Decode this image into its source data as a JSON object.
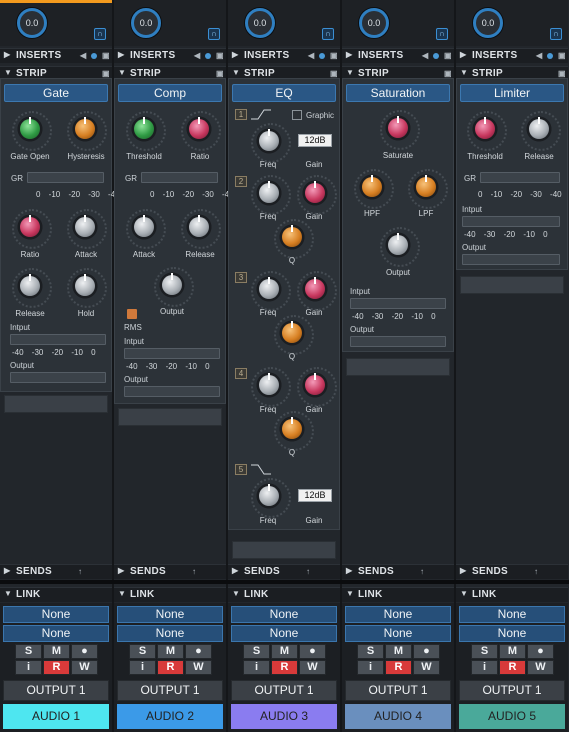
{
  "channels": [
    {
      "volume": "0.0",
      "inserts": "INSERTS",
      "strip": "STRIP",
      "plugin": "Gate",
      "sends": "SENDS",
      "link": "LINK",
      "link_a": "None",
      "link_b": "None",
      "output": "OUTPUT 1",
      "track": "AUDIO 1",
      "track_color": "#4ee6f0",
      "knobs": {
        "k1": "Gate Open",
        "k2": "Hysteresis",
        "k3": "Ratio",
        "k4": "Attack",
        "k5": "Release",
        "k6": "Hold"
      }
    },
    {
      "volume": "0.0",
      "inserts": "INSERTS",
      "strip": "STRIP",
      "plugin": "Comp",
      "sends": "SENDS",
      "link": "LINK",
      "link_a": "None",
      "link_b": "None",
      "output": "OUTPUT 1",
      "track": "AUDIO 2",
      "track_color": "#3b9ae8",
      "knobs": {
        "k1": "Threshold",
        "k2": "Ratio",
        "k3": "Attack",
        "k4": "Release",
        "k5": "Output"
      },
      "rms": "RMS"
    },
    {
      "volume": "0.0",
      "inserts": "INSERTS",
      "strip": "STRIP",
      "plugin": "EQ",
      "sends": "SENDS",
      "link": "LINK",
      "link_a": "None",
      "link_b": "None",
      "output": "OUTPUT 1",
      "track": "AUDIO 3",
      "track_color": "#8a7cf0",
      "graphic": "Graphic",
      "gain1": "12dB",
      "gain5": "12dB",
      "freq": "Freq",
      "gain": "Gain",
      "q": "Q",
      "bands": [
        "1",
        "2",
        "3",
        "4",
        "5"
      ]
    },
    {
      "volume": "0.0",
      "inserts": "INSERTS",
      "strip": "STRIP",
      "plugin": "Saturation",
      "sends": "SENDS",
      "link": "LINK",
      "link_a": "None",
      "link_b": "None",
      "output": "OUTPUT 1",
      "track": "AUDIO 4",
      "track_color": "#6a8fbe",
      "knobs": {
        "k1": "Saturate",
        "k2": "HPF",
        "k3": "LPF",
        "k4": "Output"
      }
    },
    {
      "volume": "0.0",
      "inserts": "INSERTS",
      "strip": "STRIP",
      "plugin": "Limiter",
      "sends": "SENDS",
      "link": "LINK",
      "link_a": "None",
      "link_b": "None",
      "output": "OUTPUT 1",
      "track": "AUDIO 5",
      "track_color": "#4aa99a",
      "knobs": {
        "k1": "Threshold",
        "k2": "Release"
      }
    }
  ],
  "meters": {
    "gr": "GR",
    "input": "Intput",
    "output": "Output",
    "gr_scale": "0 -10 -20 -30 -40",
    "io_scale": "-40 -30 -20 -10 0"
  },
  "buttons": {
    "s": "S",
    "m": "M",
    "r": "R",
    "i": "i",
    "w": "W",
    "dot": "●"
  },
  "icons": {
    "insert": "arrow-back",
    "sends": "arrow-up"
  }
}
